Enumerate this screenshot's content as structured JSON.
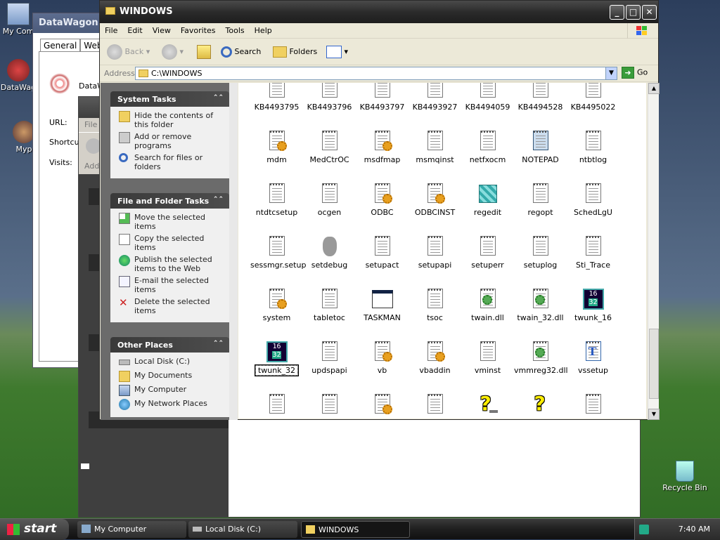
{
  "desktop": {
    "icons": [
      {
        "label": "My Com",
        "icon": "my-computer-icon"
      },
      {
        "label": "DataWag",
        "icon": "datawagon-icon"
      },
      {
        "label": "Myp",
        "icon": "mypal-icon"
      },
      {
        "label": "Recycle Bin",
        "icon": "recycle-bin-icon"
      }
    ]
  },
  "datawagon": {
    "title": "DataWagon.co",
    "tabs": [
      "General",
      "Web"
    ],
    "app_label": "DataW",
    "url_label": "URL:",
    "shortcut_label": "Shortcut",
    "visits_label": "Visits:"
  },
  "mycomputer": {
    "menu_partial": "File",
    "addr_partial": "Add"
  },
  "explorer": {
    "title": "WINDOWS",
    "menu": [
      "File",
      "Edit",
      "View",
      "Favorites",
      "Tools",
      "Help"
    ],
    "toolbar": {
      "back": "Back",
      "search": "Search",
      "folders": "Folders"
    },
    "address_label": "Address",
    "address_value": "C:\\WINDOWS",
    "go_label": "Go",
    "system_tasks": {
      "title": "System Tasks",
      "items": [
        "Hide the contents of this folder",
        "Add or remove programs",
        "Search for files or folders"
      ]
    },
    "file_tasks": {
      "title": "File and Folder Tasks",
      "items": [
        "Move the selected items",
        "Copy the selected items",
        "Publish the selected items to the Web",
        "E-mail the selected items",
        "Delete the selected items"
      ]
    },
    "other_places": {
      "title": "Other Places",
      "items": [
        "Local Disk (C:)",
        "My Documents",
        "My Computer",
        "My Network Places"
      ]
    },
    "files": [
      {
        "name": "KB4493795",
        "type": "doc"
      },
      {
        "name": "KB4493796",
        "type": "doc"
      },
      {
        "name": "KB4493797",
        "type": "doc"
      },
      {
        "name": "KB4493927",
        "type": "doc"
      },
      {
        "name": "KB4494059",
        "type": "doc"
      },
      {
        "name": "KB4494528",
        "type": "doc"
      },
      {
        "name": "KB4495022",
        "type": "doc"
      },
      {
        "name": "mdm",
        "type": "ini"
      },
      {
        "name": "MedCtrOC",
        "type": "doc"
      },
      {
        "name": "msdfmap",
        "type": "ini"
      },
      {
        "name": "msmqinst",
        "type": "doc"
      },
      {
        "name": "netfxocm",
        "type": "doc"
      },
      {
        "name": "NOTEPAD",
        "type": "notepad"
      },
      {
        "name": "ntbtlog",
        "type": "doc"
      },
      {
        "name": "ntdtcsetup",
        "type": "doc"
      },
      {
        "name": "ocgen",
        "type": "doc"
      },
      {
        "name": "ODBC",
        "type": "ini"
      },
      {
        "name": "ODBCINST",
        "type": "ini"
      },
      {
        "name": "regedit",
        "type": "regedit"
      },
      {
        "name": "regopt",
        "type": "doc"
      },
      {
        "name": "SchedLgU",
        "type": "doc"
      },
      {
        "name": "sessmgr.setup",
        "type": "doc"
      },
      {
        "name": "setdebug",
        "type": "bear"
      },
      {
        "name": "setupact",
        "type": "doc"
      },
      {
        "name": "setupapi",
        "type": "doc"
      },
      {
        "name": "setuperr",
        "type": "doc"
      },
      {
        "name": "setuplog",
        "type": "doc"
      },
      {
        "name": "Sti_Trace",
        "type": "doc"
      },
      {
        "name": "system",
        "type": "ini"
      },
      {
        "name": "tabletoc",
        "type": "doc"
      },
      {
        "name": "TASKMAN",
        "type": "window"
      },
      {
        "name": "tsoc",
        "type": "doc"
      },
      {
        "name": "twain.dll",
        "type": "dll"
      },
      {
        "name": "twain_32.dll",
        "type": "dll"
      },
      {
        "name": "twunk_16",
        "type": "twunk"
      },
      {
        "name": "twunk_32",
        "type": "twunk",
        "selected": true
      },
      {
        "name": "updspapi",
        "type": "doc"
      },
      {
        "name": "vb",
        "type": "ini"
      },
      {
        "name": "vbaddin",
        "type": "ini"
      },
      {
        "name": "vminst",
        "type": "doc"
      },
      {
        "name": "vmmreg32.dll",
        "type": "dll"
      },
      {
        "name": "vssetup",
        "type": "font"
      },
      {
        "name": "",
        "type": "doc"
      },
      {
        "name": "",
        "type": "doc"
      },
      {
        "name": "",
        "type": "ini"
      },
      {
        "name": "",
        "type": "doc"
      },
      {
        "name": "",
        "type": "help"
      },
      {
        "name": "",
        "type": "help2"
      },
      {
        "name": "",
        "type": "doc"
      }
    ],
    "twunk_text_top": "16",
    "twunk_text_bottom": "32",
    "twunk32_top": "16",
    "twunk32_bottom": "32"
  },
  "taskbar": {
    "start_label": "start",
    "tasks": [
      {
        "label": "My Computer",
        "active": false
      },
      {
        "label": "Local Disk (C:)",
        "active": false
      },
      {
        "label": "WINDOWS",
        "active": true
      }
    ],
    "clock": "7:40 AM"
  }
}
